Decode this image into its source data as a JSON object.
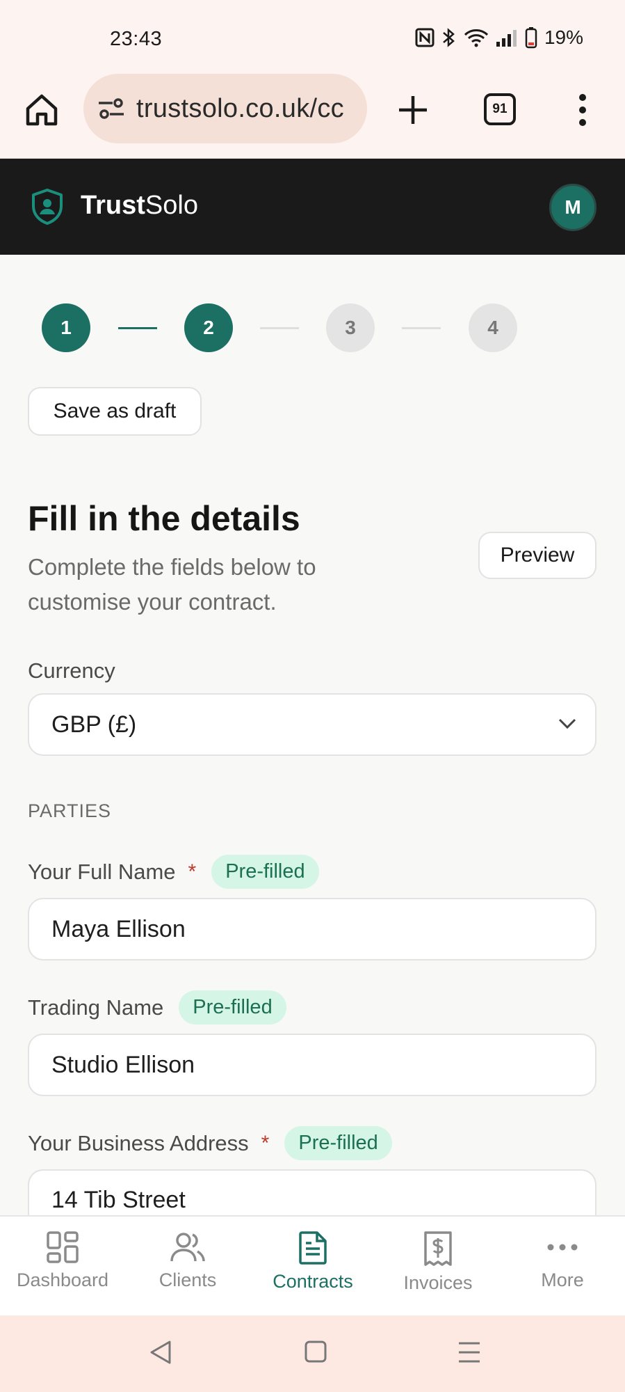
{
  "status_bar": {
    "time": "23:43",
    "battery": "19%"
  },
  "browser": {
    "url": "trustsolo.co.uk/cc",
    "tab_count": "91"
  },
  "app": {
    "brand_bold": "Trust",
    "brand_light": "Solo",
    "avatar_initial": "M"
  },
  "stepper": {
    "steps": [
      "1",
      "2",
      "3",
      "4"
    ],
    "current": 2
  },
  "actions": {
    "save_draft": "Save as draft",
    "preview": "Preview"
  },
  "form": {
    "title": "Fill in the details",
    "subtitle": "Complete the fields below to customise your contract.",
    "currency_label": "Currency",
    "currency_value": "GBP (£)",
    "section_parties": "PARTIES",
    "prefilled_badge": "Pre-filled",
    "full_name_label": "Your Full Name",
    "full_name_value": "Maya Ellison",
    "trading_name_label": "Trading Name",
    "trading_name_value": "Studio Ellison",
    "address_label": "Your Business Address",
    "address_value": "14 Tib Street",
    "required_marker": "*"
  },
  "bottom_nav": {
    "items": [
      {
        "label": "Dashboard",
        "icon": "dashboard-icon"
      },
      {
        "label": "Clients",
        "icon": "users-icon"
      },
      {
        "label": "Contracts",
        "icon": "document-icon"
      },
      {
        "label": "Invoices",
        "icon": "invoice-icon"
      },
      {
        "label": "More",
        "icon": "more-icon"
      }
    ],
    "active": "Contracts"
  },
  "colors": {
    "accent": "#1b6f63",
    "header_bg": "#1a1a1a",
    "badge_bg": "#d5f5e6",
    "required": "#c0392b"
  }
}
